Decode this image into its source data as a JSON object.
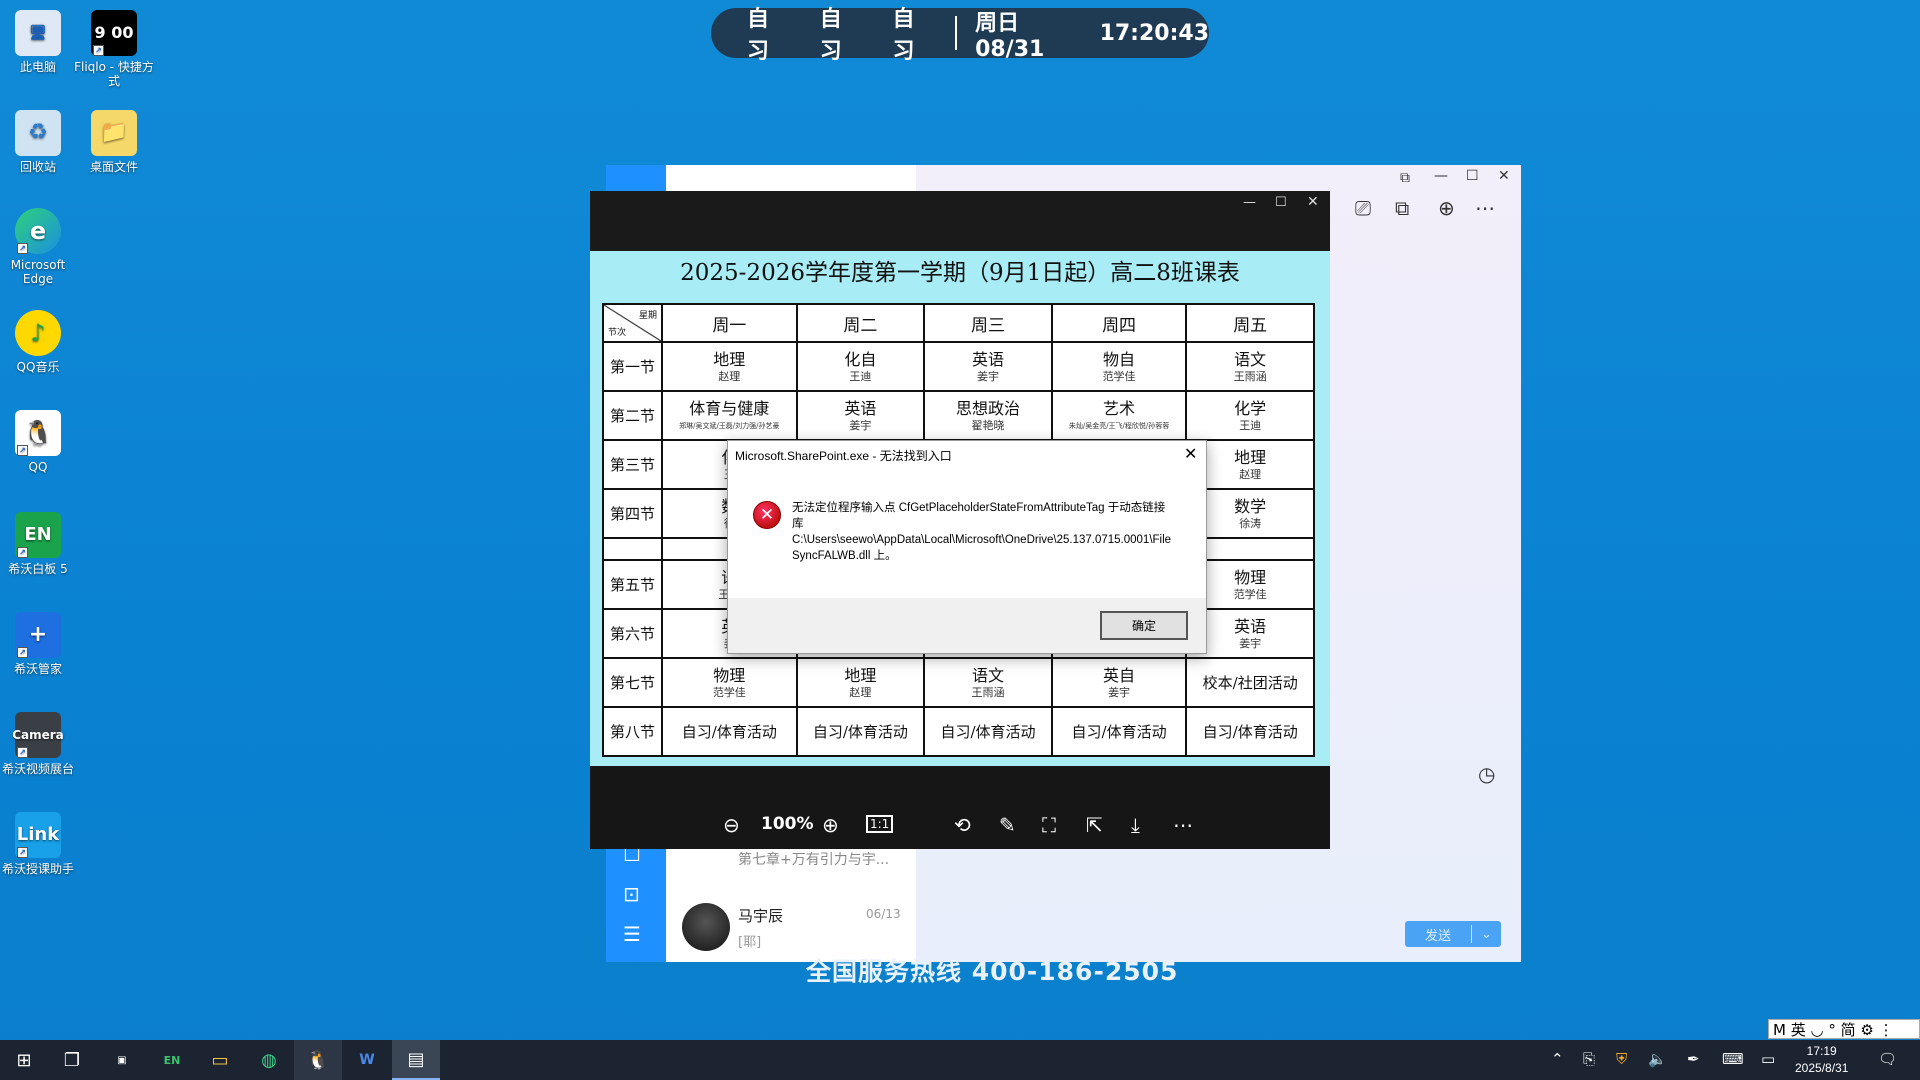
{
  "desktop": {
    "icons": [
      {
        "label": "此电脑",
        "glyph": "🖥"
      },
      {
        "label": "Fliqlo - 快捷方式",
        "glyph": "9 00"
      },
      {
        "label": "回收站",
        "glyph": "♻"
      },
      {
        "label": "桌面文件",
        "glyph": "📁"
      },
      {
        "label": "Microsoft Edge",
        "glyph": "e"
      },
      {
        "label": "QQ音乐",
        "glyph": "♪"
      },
      {
        "label": "QQ",
        "glyph": "🐧"
      },
      {
        "label": "希沃白板 5",
        "glyph": "EN"
      },
      {
        "label": "希沃管家",
        "glyph": "+"
      },
      {
        "label": "希沃视频展台",
        "glyph": "Camera"
      },
      {
        "label": "希沃授课助手",
        "glyph": "Link"
      }
    ]
  },
  "banner": {
    "lessons": [
      "自习",
      "自习",
      "自习"
    ],
    "date": "周日 08/31",
    "time": "17:20:43"
  },
  "qq": {
    "chat_preview_1": "第七章+万有引力与宇...",
    "contact_name": "马宇辰",
    "contact_date": "06/13",
    "contact_msg": "[耶]",
    "send_label": "发送",
    "hotline": "全国服务热线 400-186-2505"
  },
  "viewer": {
    "zoom": "100%",
    "ratio_label": "1:1",
    "title": "2025-2026学年度第一学期（9月1日起）高二8班课表",
    "corner_top": "星期",
    "corner_bottom": "节次",
    "days": [
      "周一",
      "周二",
      "周三",
      "周四",
      "周五"
    ],
    "rows": [
      {
        "period": "第一节",
        "cells": [
          [
            "地理",
            "赵理"
          ],
          [
            "化自",
            "王迪"
          ],
          [
            "英语",
            "姜宇"
          ],
          [
            "物自",
            "范学佳"
          ],
          [
            "语文",
            "王雨涵"
          ]
        ]
      },
      {
        "period": "第二节",
        "cells": [
          [
            "体育与健康",
            "郑琳/吴文斌/王磊/刘力强/孙艺豪"
          ],
          [
            "英语",
            "姜宇"
          ],
          [
            "思想政治",
            "翟艳晓"
          ],
          [
            "艺术",
            "朱灿/吴金亮/王飞/程欣悦/孙蓉蓉"
          ],
          [
            "化学",
            "王迪"
          ]
        ]
      },
      {
        "period": "第三节",
        "cells": [
          [
            "化",
            "王"
          ],
          [
            "",
            ""
          ],
          [
            "",
            ""
          ],
          [
            "",
            ""
          ],
          [
            "地理",
            "赵理"
          ]
        ]
      },
      {
        "period": "第四节",
        "cells": [
          [
            "数",
            "徐"
          ],
          [
            "",
            ""
          ],
          [
            "",
            ""
          ],
          [
            "",
            ""
          ],
          [
            "数学",
            "徐涛"
          ]
        ]
      },
      {
        "period": "",
        "cells": [
          [
            "",
            ""
          ],
          [
            "",
            ""
          ],
          [
            "",
            ""
          ],
          [
            "",
            ""
          ],
          [
            "",
            ""
          ]
        ]
      },
      {
        "period": "第五节",
        "cells": [
          [
            "语",
            "王雨"
          ],
          [
            "",
            ""
          ],
          [
            "",
            ""
          ],
          [
            "",
            ""
          ],
          [
            "物理",
            "范学佳"
          ]
        ]
      },
      {
        "period": "第六节",
        "cells": [
          [
            "英",
            "姜"
          ],
          [
            "",
            ""
          ],
          [
            "",
            ""
          ],
          [
            "",
            ""
          ],
          [
            "英语",
            "姜宇"
          ]
        ]
      },
      {
        "period": "第七节",
        "cells": [
          [
            "物理",
            "范学佳"
          ],
          [
            "地理",
            "赵理"
          ],
          [
            "语文",
            "王雨涵"
          ],
          [
            "英自",
            "姜宇"
          ],
          [
            "校本/社团活动",
            ""
          ]
        ]
      },
      {
        "period": "第八节",
        "cells": [
          [
            "自习/体育活动",
            ""
          ],
          [
            "自习/体育活动",
            ""
          ],
          [
            "自习/体育活动",
            ""
          ],
          [
            "自习/体育活动",
            ""
          ],
          [
            "自习/体育活动",
            ""
          ]
        ]
      }
    ]
  },
  "dialog": {
    "title": "Microsoft.SharePoint.exe - 无法找到入口",
    "message_line1": "无法定位程序输入点 CfGetPlaceholderStateFromAttributeTag 于动态链接库",
    "message_line2": "C:\\Users\\seewo\\AppData\\Local\\Microsoft\\OneDrive\\25.137.0715.0001\\FileSyncFALWB.dll 上。",
    "ok_label": "确定"
  },
  "taskbar": {
    "clock_time": "17:19",
    "clock_date": "2025/8/31",
    "ime": "M 英 ◡ ° 简 ⚙ ⋮"
  }
}
